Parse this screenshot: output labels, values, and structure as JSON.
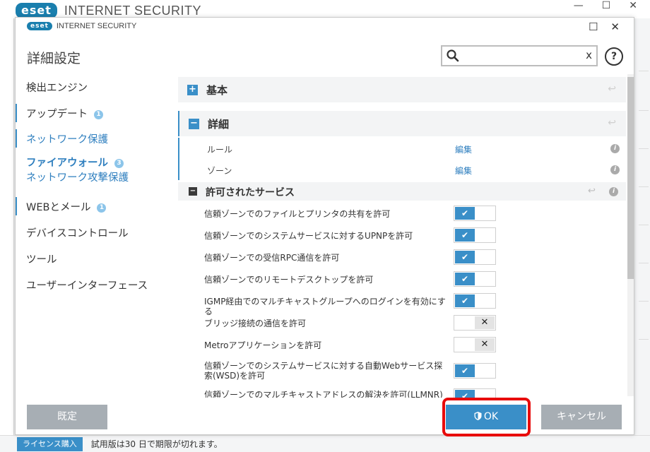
{
  "background_app": {
    "brand_badge": "eset",
    "brand_text": "INTERNET SECURITY",
    "controls": [
      "—",
      "☐",
      "✕"
    ],
    "status_bar": {
      "license_button": "ライセンス購入",
      "trial_text": "試用版は30 日で期限が切れます。"
    }
  },
  "dialog": {
    "brand_badge": "eset",
    "brand_text": "INTERNET SECURITY",
    "controls": {
      "maximize": "☐",
      "close": "✕"
    },
    "heading": "詳細設定",
    "search": {
      "value": "",
      "placeholder": "",
      "clear": "x"
    },
    "help": "?"
  },
  "sidebar": {
    "items": [
      {
        "label": "検出エンジン"
      },
      {
        "label": "アップデート",
        "badge": "1"
      },
      {
        "label": "ネットワーク保護"
      },
      {
        "label": "ファイアウォール",
        "badge": "3",
        "sub": "ネットワーク攻撃保護"
      },
      {
        "label": "WEBとメール",
        "badge": "1"
      },
      {
        "label": "デバイスコントロール"
      },
      {
        "label": "ツール"
      },
      {
        "label": "ユーザーインターフェース"
      }
    ]
  },
  "content": {
    "basic": {
      "toggle": "+",
      "title": "基本",
      "revert": "↩"
    },
    "advanced": {
      "toggle": "−",
      "title": "詳細",
      "revert": "↩"
    },
    "rules": {
      "label": "ルール",
      "link": "編集",
      "info": "i"
    },
    "zones": {
      "label": "ゾーン",
      "link": "編集",
      "info": "i"
    },
    "allowed_services": {
      "toggle": "−",
      "title": "許可されたサービス",
      "revert": "↩",
      "info": "i"
    },
    "settings": [
      {
        "label": "信頼ゾーンでのファイルとプリンタの共有を許可",
        "enabled": true
      },
      {
        "label": "信頼ゾーンでのシステムサービスに対するUPNPを許可",
        "enabled": true
      },
      {
        "label": "信頼ゾーンでの受信RPC通信を許可",
        "enabled": true
      },
      {
        "label": "信頼ゾーンでのリモートデスクトップを許可",
        "enabled": true
      },
      {
        "label": "IGMP経由でのマルチキャストグループへのログインを有効にする",
        "enabled": true
      },
      {
        "label": "ブリッジ接続の通信を許可",
        "enabled": false
      },
      {
        "label": "Metroアプリケーションを許可",
        "enabled": false
      },
      {
        "label": "信頼ゾーンでのシステムサービスに対する自動Webサービス探索(WSD)を許可",
        "enabled": true
      },
      {
        "label": "信頼ゾーンでのマルチキャストアドレスの解決を許可(LLMNR)",
        "enabled": true
      }
    ],
    "switch_on_glyph": "✔",
    "switch_off_glyph": "✕"
  },
  "footer": {
    "default_button": "既定",
    "ok_button": "OK",
    "cancel_button": "キャンセル"
  },
  "colors": {
    "accent": "#3a8fc8",
    "highlight": "#e80b0b",
    "gray_button": "#a7aeb4"
  }
}
